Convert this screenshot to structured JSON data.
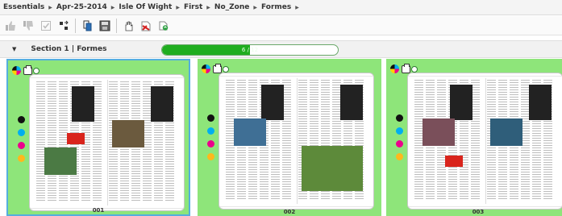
{
  "breadcrumb": {
    "items": [
      "Essentials",
      "Apr-25-2014",
      "Isle Of Wight",
      "First",
      "No_Zone",
      "Formes"
    ],
    "separator": "▶"
  },
  "toolbar": {
    "buttons": [
      {
        "name": "approve-icon",
        "glyph": "👍"
      },
      {
        "name": "reject-icon",
        "glyph": "👎"
      },
      {
        "name": "check-icon",
        "glyph": "☑"
      },
      {
        "name": "shuffle-icon",
        "glyph": "⇄"
      },
      {
        "name": "page-copy-icon",
        "glyph": "⎘"
      },
      {
        "name": "save-icon",
        "glyph": "▦"
      },
      {
        "name": "hand-icon",
        "glyph": "☞"
      },
      {
        "name": "pdf-icon",
        "glyph": "⛛"
      },
      {
        "name": "recycle-icon",
        "glyph": "♻"
      }
    ]
  },
  "section": {
    "toggle_glyph": "▼",
    "title": "Section 1 | Formes",
    "progress_text": "6 / 12",
    "progress_fraction": 0.5,
    "progress_color": "#1fad1f"
  },
  "cards": [
    {
      "label": "001",
      "selected": true
    },
    {
      "label": "002",
      "selected": false
    },
    {
      "label": "003",
      "selected": false
    }
  ],
  "colors": {
    "card_background": "#8ee57a",
    "selected_border": "#55aede",
    "ink_dots": [
      "#111111",
      "#00aeef",
      "#ec008c",
      "#ffb81c"
    ]
  }
}
